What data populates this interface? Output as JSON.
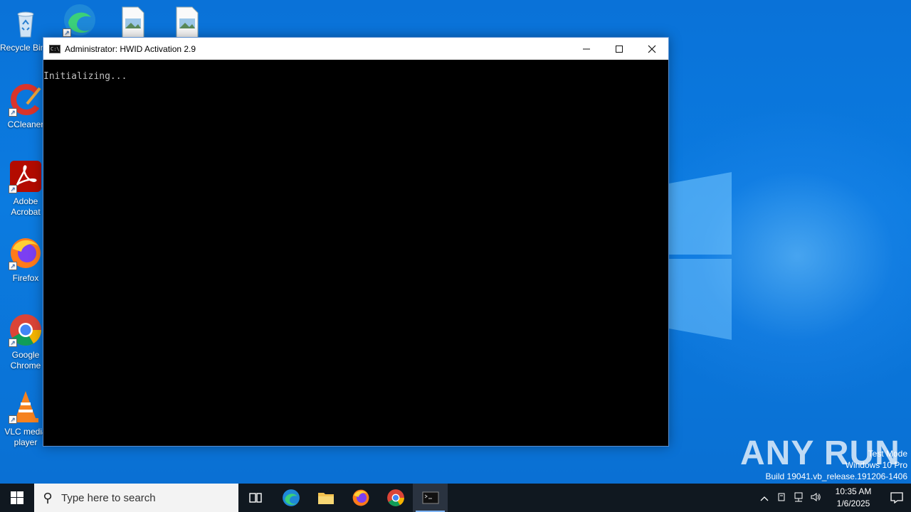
{
  "desktop": {
    "icons": [
      {
        "label": "Recycle Bin",
        "icon": "recycle-bin-icon"
      },
      {
        "label": "Microsoft Edge",
        "icon": "edge-icon"
      },
      {
        "label": "",
        "icon": "image-file-icon"
      },
      {
        "label": "",
        "icon": "image-file-icon"
      },
      {
        "label": "CCleaner",
        "icon": "ccleaner-icon"
      },
      {
        "label": "Adobe Acrobat",
        "icon": "acrobat-icon"
      },
      {
        "label": "Firefox",
        "icon": "firefox-icon"
      },
      {
        "label": "Google Chrome",
        "icon": "chrome-icon"
      },
      {
        "label": "VLC media player",
        "icon": "vlc-icon"
      }
    ]
  },
  "console": {
    "title": "Administrator:  HWID Activation 2.9",
    "output": "Initializing..."
  },
  "watermark": {
    "brand": "ANY RUN",
    "line1": "Test Mode",
    "line2": "Windows 10 Pro",
    "line3": "Build 19041.vb_release.191206-1406"
  },
  "taskbar": {
    "search_placeholder": "Type here to search",
    "clock_time": "10:35 AM",
    "clock_date": "1/6/2025",
    "pinned": [
      "task-view",
      "edge",
      "file-explorer",
      "firefox",
      "chrome",
      "cmd"
    ]
  },
  "colors": {
    "desktop": "#0b78dc",
    "taskbar": "#101820",
    "console_bg": "#000000",
    "console_text": "#c0c0c0"
  }
}
